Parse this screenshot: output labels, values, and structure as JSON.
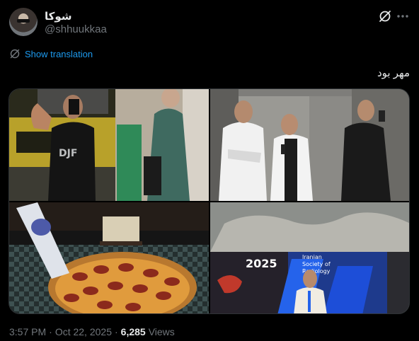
{
  "author": {
    "name": "شوکا",
    "handle": "@shhuukkaa"
  },
  "translation": {
    "label": "Show translation"
  },
  "tweet": {
    "text": "مهر بود"
  },
  "media": {
    "images": [
      {
        "alt": "gym-mirror-selfie-and-street-photo"
      },
      {
        "alt": "elevator-photos-in-white-coats"
      },
      {
        "alt": "pepperoni-pizza-on-table"
      },
      {
        "alt": "radiology-congress-2025-photo"
      }
    ],
    "congress_year": "2025",
    "congress_name_line1": "Iranian",
    "congress_name_line2": "Society of",
    "congress_name_line3": "Radiology"
  },
  "meta": {
    "time": "3:57 PM",
    "separator": "·",
    "date": "Oct 22, 2025",
    "views_count": "6,285",
    "views_label": "Views"
  },
  "colors": {
    "link": "#1d9bf0",
    "secondary_text": "#71767b",
    "primary_text": "#e7e9ea",
    "background": "#000000"
  },
  "icons": [
    "grok-icon",
    "more-icon",
    "translate-icon"
  ]
}
